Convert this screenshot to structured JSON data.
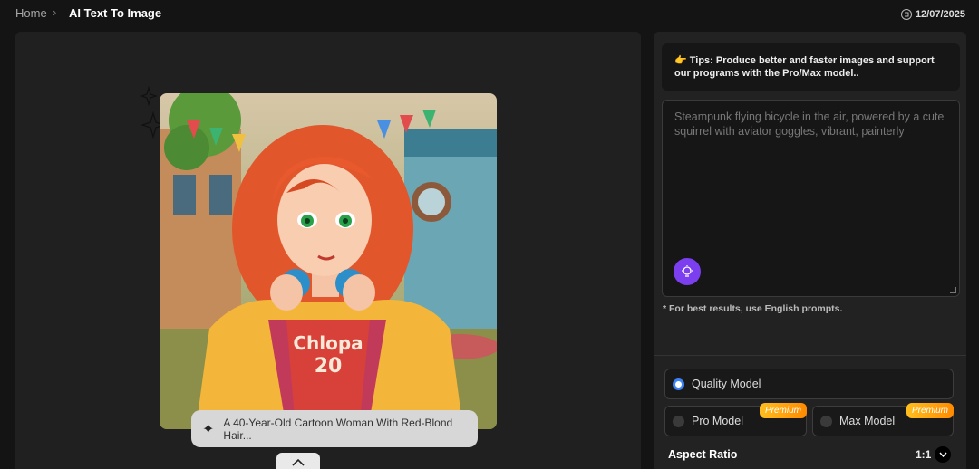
{
  "breadcrumb": {
    "home": "Home",
    "separator": "›",
    "current": "AI Text To Image"
  },
  "credits": {
    "icon": "credit-icon",
    "value": "12/07/2025"
  },
  "preview": {
    "caption": "A 40-Year-Old Cartoon Woman With Red-Blond Hair...",
    "caption_icon": "sparkle-icon",
    "shirt_text_top": "Chlopa",
    "shirt_text_bottom": "20"
  },
  "sidebar": {
    "tips": "👉 Tips: Produce better and faster images and support our programs with the Pro/Max model..",
    "prompt_placeholder": "Steampunk flying bicycle in the air, powered by a cute squirrel with aviator goggles, vibrant, painterly",
    "prompt_value": "",
    "hint": "* For best results, use English prompts.",
    "models": [
      {
        "label": "Quality Model",
        "selected": true,
        "badge": ""
      },
      {
        "label": "Pro Model",
        "selected": false,
        "badge": "Premium"
      },
      {
        "label": "Max Model",
        "selected": false,
        "badge": "Premium"
      }
    ],
    "aspect_ratio": {
      "label": "Aspect Ratio",
      "value": "1:1"
    }
  },
  "colors": {
    "accent_blue": "#3b82f6",
    "bulb_purple": "#7b3ff0",
    "premium_orange": "#ff9f0a"
  }
}
